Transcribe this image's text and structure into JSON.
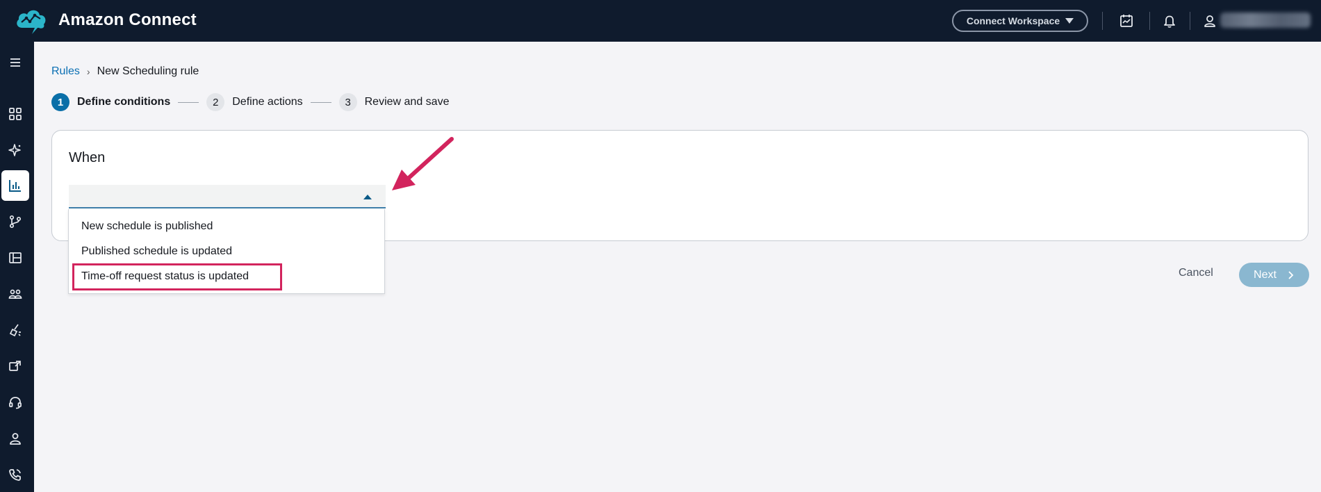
{
  "header": {
    "app_title": "Amazon Connect",
    "workspace_button": "Connect Workspace",
    "icons": [
      "connect-cloud-logo-icon",
      "calendar-icon",
      "bell-icon",
      "user-icon"
    ]
  },
  "sidenav": {
    "items": [
      {
        "icon": "menu-icon"
      },
      {
        "icon": "dashboard-grid-icon"
      },
      {
        "icon": "sparkle-icon"
      },
      {
        "icon": "analytics-chart-icon",
        "active": true
      },
      {
        "icon": "routing-branch-icon"
      },
      {
        "icon": "table-layout-icon"
      },
      {
        "icon": "users-group-icon"
      },
      {
        "icon": "cleaning-icon"
      },
      {
        "icon": "channels-icon"
      },
      {
        "icon": "headset-icon"
      },
      {
        "icon": "user-profile-icon"
      },
      {
        "icon": "phone-icon"
      }
    ]
  },
  "breadcrumb": {
    "root": "Rules",
    "separator": "›",
    "current": "New Scheduling rule"
  },
  "steps": [
    {
      "number": "1",
      "label": "Define conditions",
      "active": true
    },
    {
      "number": "2",
      "label": "Define actions",
      "active": false
    },
    {
      "number": "3",
      "label": "Review and save",
      "active": false
    }
  ],
  "card": {
    "title": "When",
    "select_value": ""
  },
  "dropdown": {
    "options": [
      "New schedule is published",
      "Published schedule is updated",
      "Time-off request status is updated"
    ],
    "highlighted_option": "Time-off request status is updated"
  },
  "actions": {
    "cancel": "Cancel",
    "next": "Next"
  },
  "colors": {
    "header_bg": "#0f1b2d",
    "accent": "#0a6fa8",
    "annotation": "#d2245d",
    "next_disabled": "#8ab7d0"
  }
}
